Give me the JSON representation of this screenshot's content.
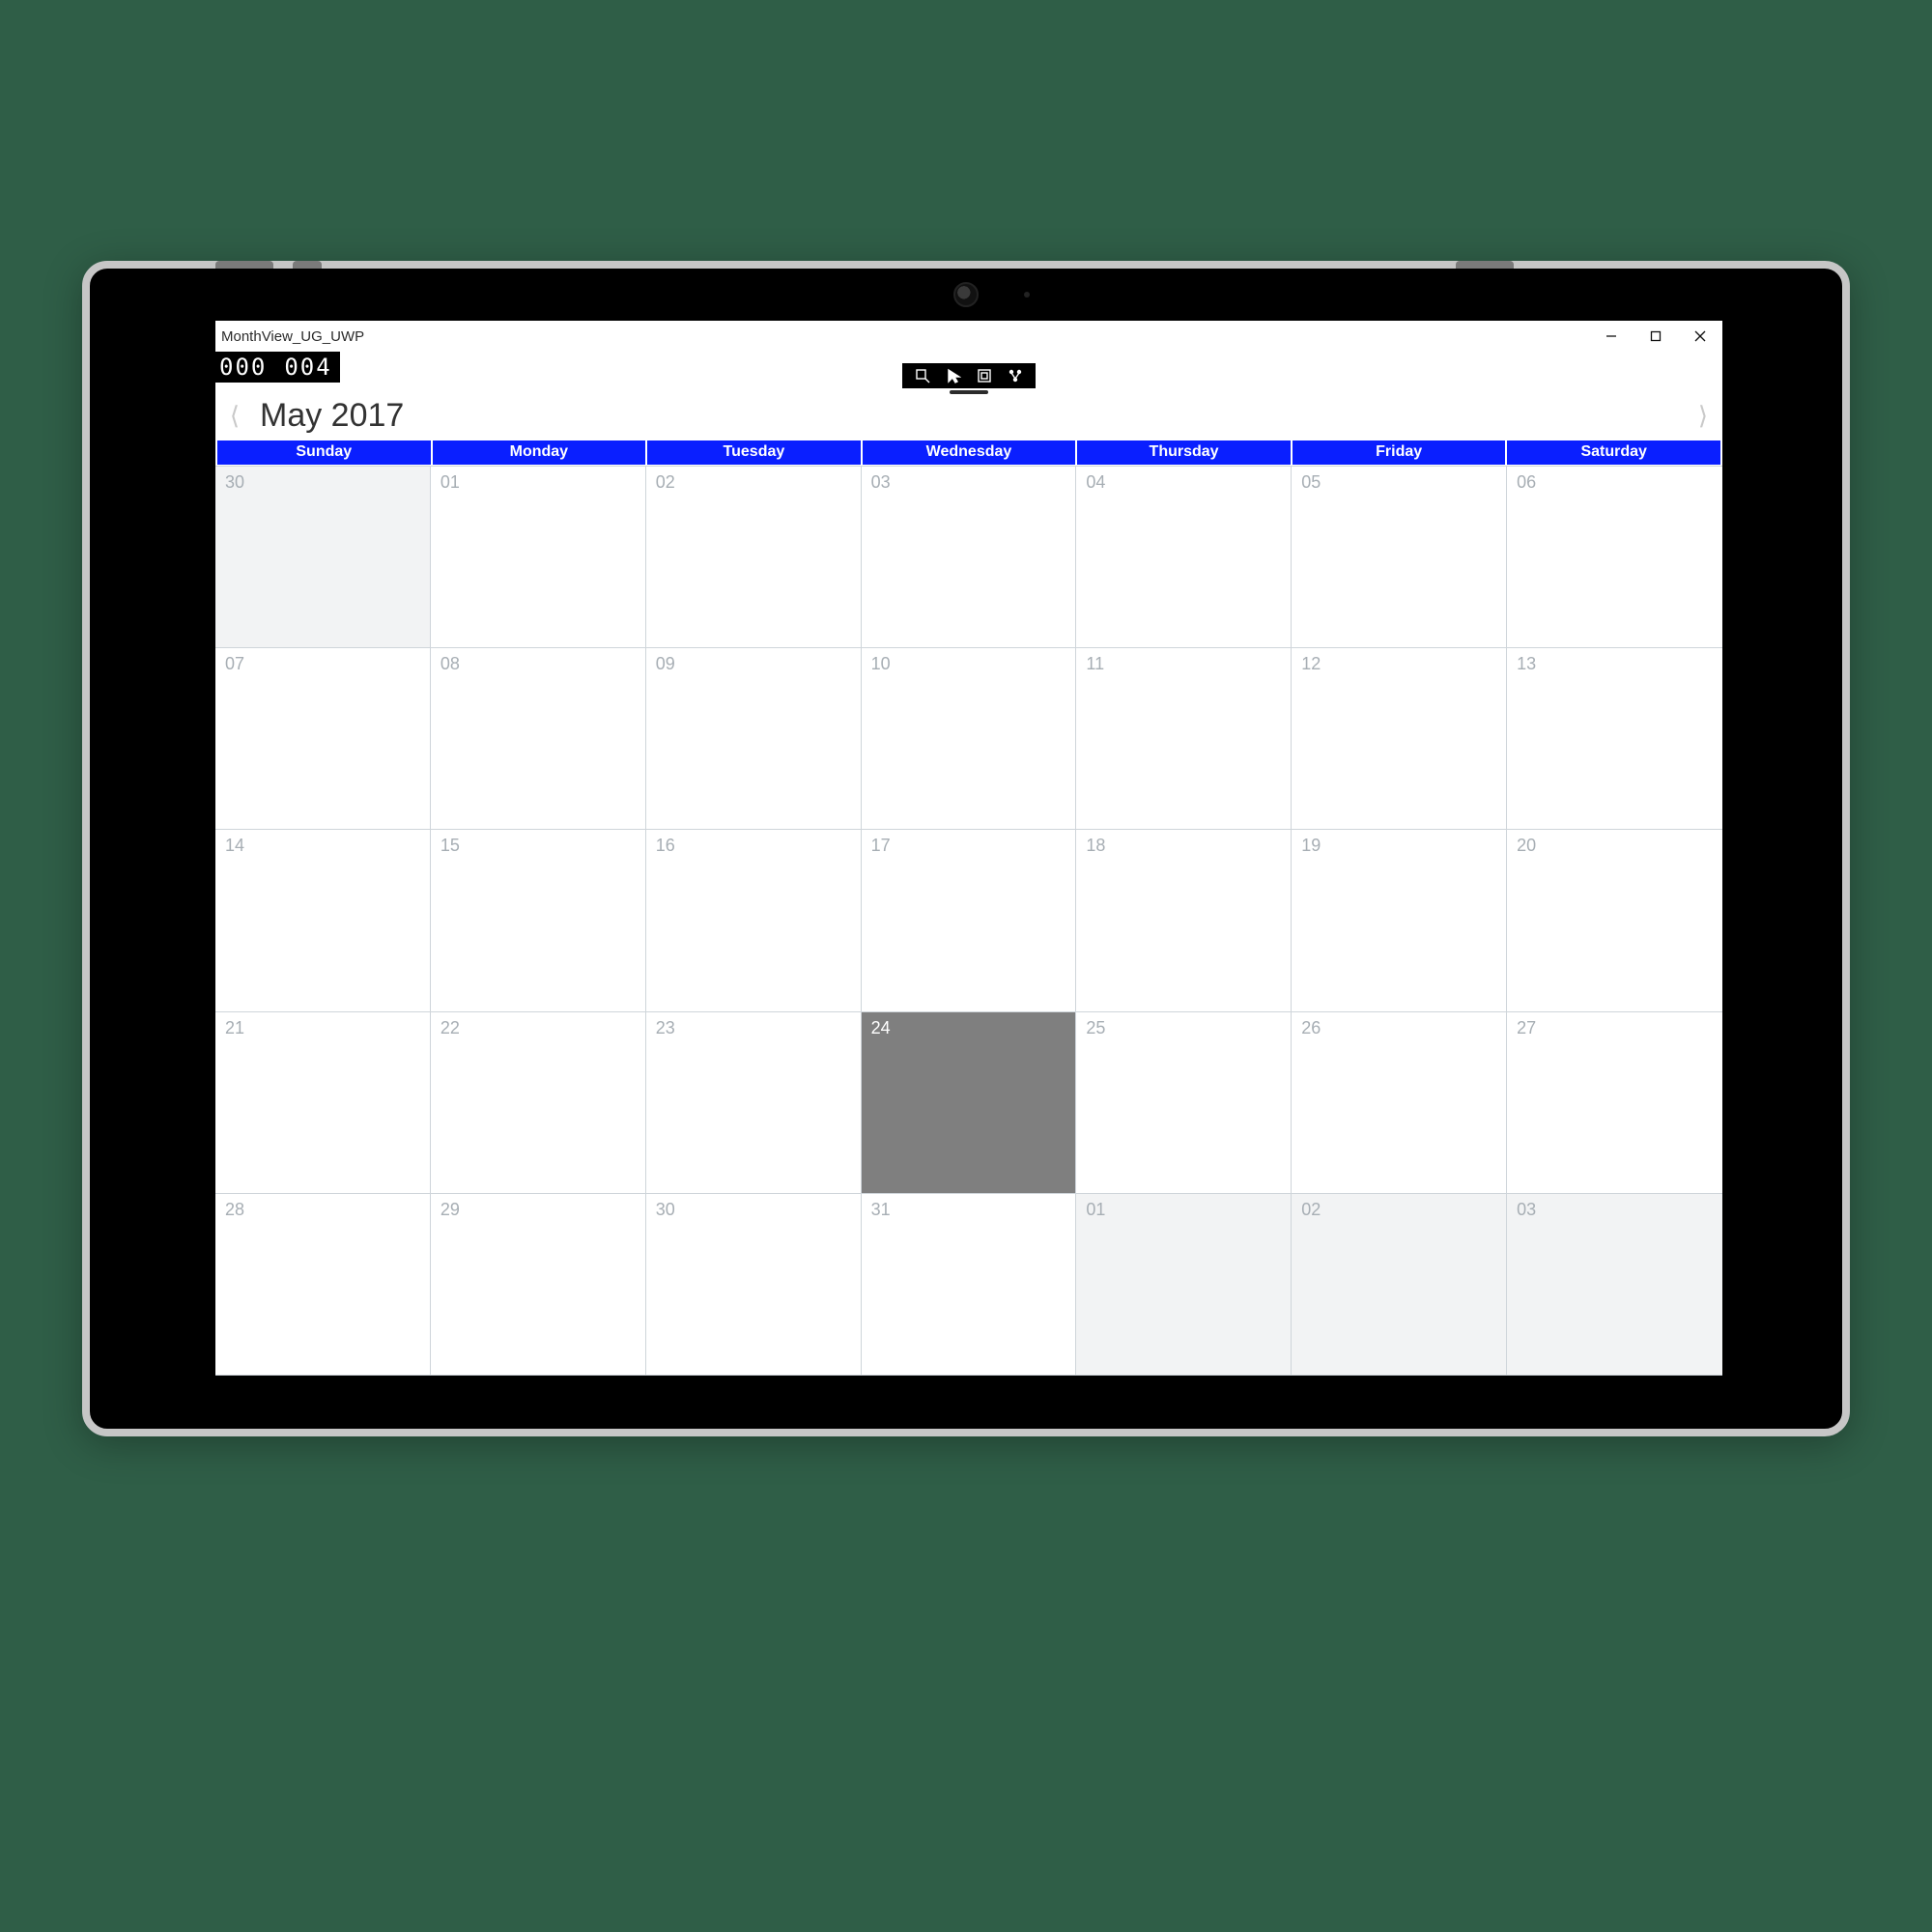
{
  "window": {
    "title": "MonthView_UG_UWP"
  },
  "counter": {
    "left": "000",
    "right": "004"
  },
  "header": {
    "month_label": "May 2017"
  },
  "weekdays": [
    "Sunday",
    "Monday",
    "Tuesday",
    "Wednesday",
    "Thursday",
    "Friday",
    "Saturday"
  ],
  "cells": [
    {
      "n": "30",
      "out": true
    },
    {
      "n": "01"
    },
    {
      "n": "02"
    },
    {
      "n": "03"
    },
    {
      "n": "04"
    },
    {
      "n": "05"
    },
    {
      "n": "06"
    },
    {
      "n": "07"
    },
    {
      "n": "08"
    },
    {
      "n": "09"
    },
    {
      "n": "10"
    },
    {
      "n": "11"
    },
    {
      "n": "12"
    },
    {
      "n": "13"
    },
    {
      "n": "14"
    },
    {
      "n": "15"
    },
    {
      "n": "16"
    },
    {
      "n": "17"
    },
    {
      "n": "18"
    },
    {
      "n": "19"
    },
    {
      "n": "20"
    },
    {
      "n": "21"
    },
    {
      "n": "22"
    },
    {
      "n": "23"
    },
    {
      "n": "24",
      "today": true
    },
    {
      "n": "25"
    },
    {
      "n": "26"
    },
    {
      "n": "27"
    },
    {
      "n": "28"
    },
    {
      "n": "29"
    },
    {
      "n": "30"
    },
    {
      "n": "31"
    },
    {
      "n": "01",
      "out": true
    },
    {
      "n": "02",
      "out": true
    },
    {
      "n": "03",
      "out": true
    }
  ],
  "colors": {
    "accent": "#0a1fff",
    "today_bg": "#7f7f7f"
  }
}
